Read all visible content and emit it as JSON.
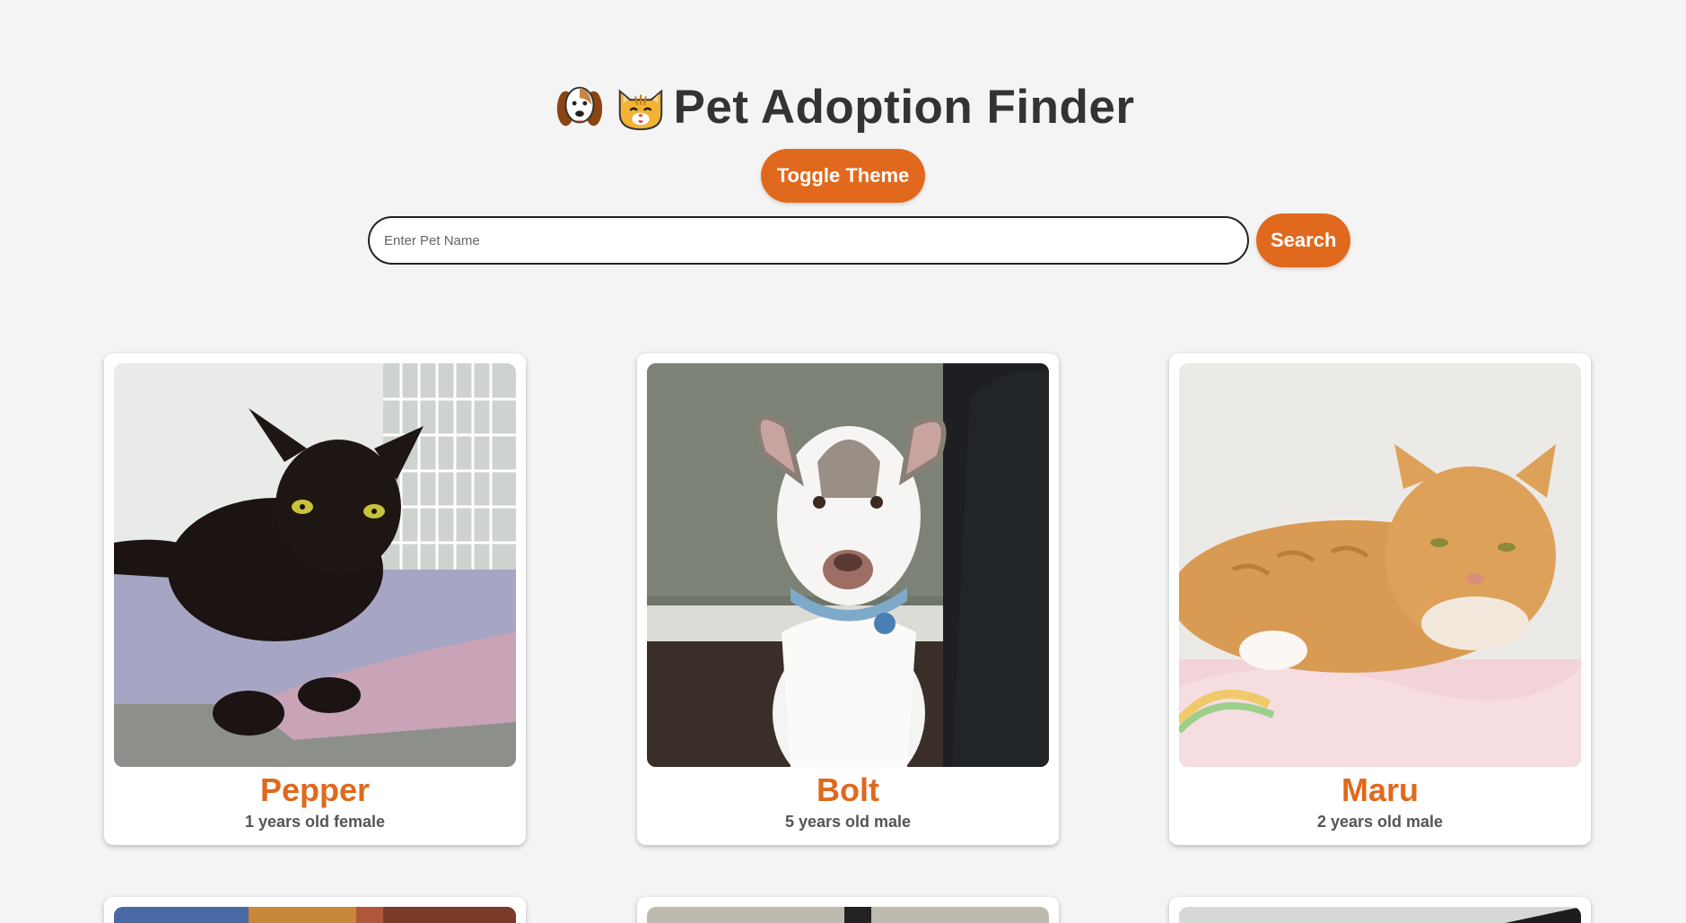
{
  "header": {
    "title": "Pet Adoption Finder",
    "dog_emoji_icon": "dog-face-icon",
    "cat_emoji_icon": "cat-face-icon"
  },
  "toggle_theme": {
    "label": "Toggle Theme"
  },
  "search": {
    "placeholder": "Enter Pet Name",
    "value": "",
    "button_label": "Search"
  },
  "colors": {
    "accent": "#e0691d",
    "background": "#f4f4f4",
    "card": "#ffffff"
  },
  "pets": [
    {
      "name": "Pepper",
      "info": "1 years old female",
      "photo": "black-cat-photo"
    },
    {
      "name": "Bolt",
      "info": "5 years old male",
      "photo": "white-puppy-photo"
    },
    {
      "name": "Maru",
      "info": "2 years old male",
      "photo": "orange-cat-photo"
    }
  ]
}
